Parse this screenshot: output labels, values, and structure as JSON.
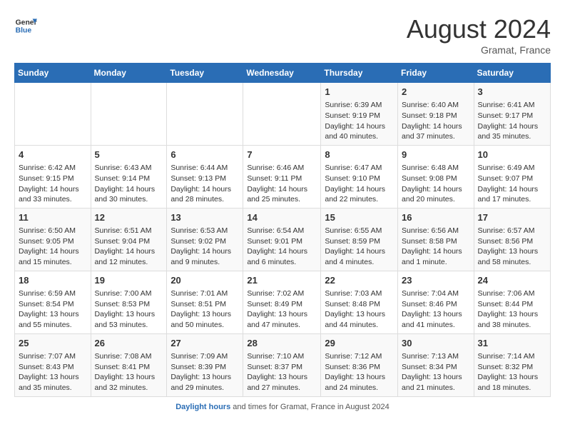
{
  "header": {
    "logo_line1": "General",
    "logo_line2": "Blue",
    "month_year": "August 2024",
    "location": "Gramat, France"
  },
  "weekdays": [
    "Sunday",
    "Monday",
    "Tuesday",
    "Wednesday",
    "Thursday",
    "Friday",
    "Saturday"
  ],
  "weeks": [
    [
      {
        "day": "",
        "info": ""
      },
      {
        "day": "",
        "info": ""
      },
      {
        "day": "",
        "info": ""
      },
      {
        "day": "",
        "info": ""
      },
      {
        "day": "1",
        "info": "Sunrise: 6:39 AM\nSunset: 9:19 PM\nDaylight: 14 hours\nand 40 minutes."
      },
      {
        "day": "2",
        "info": "Sunrise: 6:40 AM\nSunset: 9:18 PM\nDaylight: 14 hours\nand 37 minutes."
      },
      {
        "day": "3",
        "info": "Sunrise: 6:41 AM\nSunset: 9:17 PM\nDaylight: 14 hours\nand 35 minutes."
      }
    ],
    [
      {
        "day": "4",
        "info": "Sunrise: 6:42 AM\nSunset: 9:15 PM\nDaylight: 14 hours\nand 33 minutes."
      },
      {
        "day": "5",
        "info": "Sunrise: 6:43 AM\nSunset: 9:14 PM\nDaylight: 14 hours\nand 30 minutes."
      },
      {
        "day": "6",
        "info": "Sunrise: 6:44 AM\nSunset: 9:13 PM\nDaylight: 14 hours\nand 28 minutes."
      },
      {
        "day": "7",
        "info": "Sunrise: 6:46 AM\nSunset: 9:11 PM\nDaylight: 14 hours\nand 25 minutes."
      },
      {
        "day": "8",
        "info": "Sunrise: 6:47 AM\nSunset: 9:10 PM\nDaylight: 14 hours\nand 22 minutes."
      },
      {
        "day": "9",
        "info": "Sunrise: 6:48 AM\nSunset: 9:08 PM\nDaylight: 14 hours\nand 20 minutes."
      },
      {
        "day": "10",
        "info": "Sunrise: 6:49 AM\nSunset: 9:07 PM\nDaylight: 14 hours\nand 17 minutes."
      }
    ],
    [
      {
        "day": "11",
        "info": "Sunrise: 6:50 AM\nSunset: 9:05 PM\nDaylight: 14 hours\nand 15 minutes."
      },
      {
        "day": "12",
        "info": "Sunrise: 6:51 AM\nSunset: 9:04 PM\nDaylight: 14 hours\nand 12 minutes."
      },
      {
        "day": "13",
        "info": "Sunrise: 6:53 AM\nSunset: 9:02 PM\nDaylight: 14 hours\nand 9 minutes."
      },
      {
        "day": "14",
        "info": "Sunrise: 6:54 AM\nSunset: 9:01 PM\nDaylight: 14 hours\nand 6 minutes."
      },
      {
        "day": "15",
        "info": "Sunrise: 6:55 AM\nSunset: 8:59 PM\nDaylight: 14 hours\nand 4 minutes."
      },
      {
        "day": "16",
        "info": "Sunrise: 6:56 AM\nSunset: 8:58 PM\nDaylight: 14 hours\nand 1 minute."
      },
      {
        "day": "17",
        "info": "Sunrise: 6:57 AM\nSunset: 8:56 PM\nDaylight: 13 hours\nand 58 minutes."
      }
    ],
    [
      {
        "day": "18",
        "info": "Sunrise: 6:59 AM\nSunset: 8:54 PM\nDaylight: 13 hours\nand 55 minutes."
      },
      {
        "day": "19",
        "info": "Sunrise: 7:00 AM\nSunset: 8:53 PM\nDaylight: 13 hours\nand 53 minutes."
      },
      {
        "day": "20",
        "info": "Sunrise: 7:01 AM\nSunset: 8:51 PM\nDaylight: 13 hours\nand 50 minutes."
      },
      {
        "day": "21",
        "info": "Sunrise: 7:02 AM\nSunset: 8:49 PM\nDaylight: 13 hours\nand 47 minutes."
      },
      {
        "day": "22",
        "info": "Sunrise: 7:03 AM\nSunset: 8:48 PM\nDaylight: 13 hours\nand 44 minutes."
      },
      {
        "day": "23",
        "info": "Sunrise: 7:04 AM\nSunset: 8:46 PM\nDaylight: 13 hours\nand 41 minutes."
      },
      {
        "day": "24",
        "info": "Sunrise: 7:06 AM\nSunset: 8:44 PM\nDaylight: 13 hours\nand 38 minutes."
      }
    ],
    [
      {
        "day": "25",
        "info": "Sunrise: 7:07 AM\nSunset: 8:43 PM\nDaylight: 13 hours\nand 35 minutes."
      },
      {
        "day": "26",
        "info": "Sunrise: 7:08 AM\nSunset: 8:41 PM\nDaylight: 13 hours\nand 32 minutes."
      },
      {
        "day": "27",
        "info": "Sunrise: 7:09 AM\nSunset: 8:39 PM\nDaylight: 13 hours\nand 29 minutes."
      },
      {
        "day": "28",
        "info": "Sunrise: 7:10 AM\nSunset: 8:37 PM\nDaylight: 13 hours\nand 27 minutes."
      },
      {
        "day": "29",
        "info": "Sunrise: 7:12 AM\nSunset: 8:36 PM\nDaylight: 13 hours\nand 24 minutes."
      },
      {
        "day": "30",
        "info": "Sunrise: 7:13 AM\nSunset: 8:34 PM\nDaylight: 13 hours\nand 21 minutes."
      },
      {
        "day": "31",
        "info": "Sunrise: 7:14 AM\nSunset: 8:32 PM\nDaylight: 13 hours\nand 18 minutes."
      }
    ]
  ],
  "footer": {
    "label": "Daylight hours",
    "text": "and times for Gramat, France in August 2024"
  }
}
